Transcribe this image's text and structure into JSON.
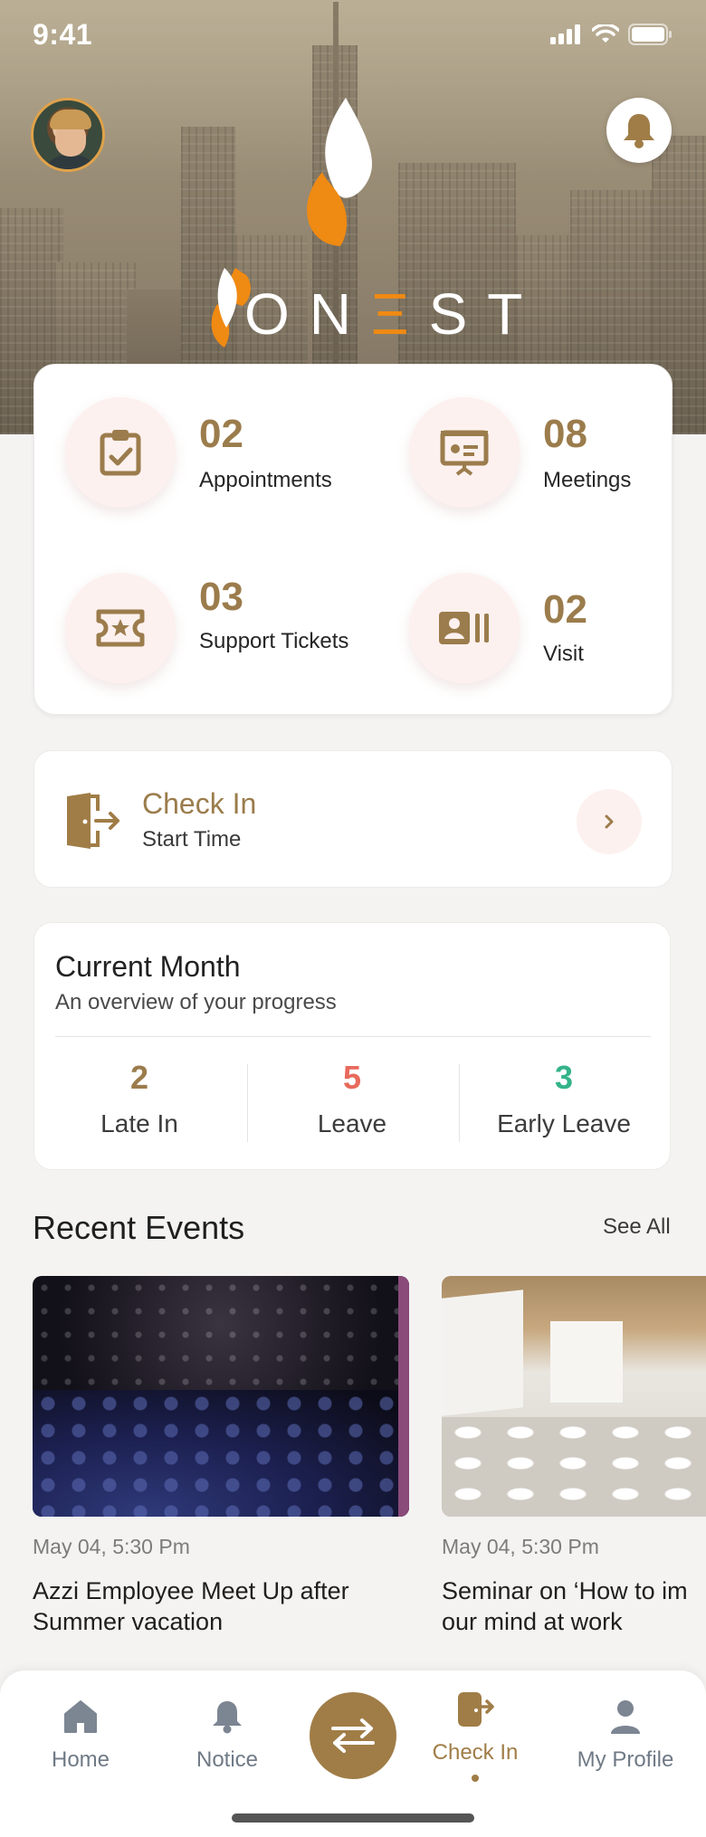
{
  "status_bar": {
    "time": "9:41"
  },
  "header": {
    "logo_text_pre": "ON",
    "logo_text_e": "Ξ",
    "logo_text_post": "ST"
  },
  "stats": [
    {
      "value": "02",
      "label": "Appointments",
      "icon": "clipboard-check-icon"
    },
    {
      "value": "08",
      "label": "Meetings",
      "icon": "presentation-board-icon"
    },
    {
      "value": "03",
      "label": "Support Tickets",
      "icon": "ticket-star-icon"
    },
    {
      "value": "02",
      "label": "Visit",
      "icon": "id-card-icon"
    }
  ],
  "checkin": {
    "title": "Check In",
    "subtitle": "Start Time"
  },
  "month": {
    "title": "Current Month",
    "subtitle": "An overview of your progress",
    "items": [
      {
        "value": "2",
        "label": "Late In",
        "color": "#9b7c4c"
      },
      {
        "value": "5",
        "label": "Leave",
        "color": "#e86a5c"
      },
      {
        "value": "3",
        "label": "Early Leave",
        "color": "#34b38a"
      }
    ]
  },
  "events": {
    "title": "Recent Events",
    "see_all": "See All",
    "items": [
      {
        "date": "May 04, 5:30 Pm",
        "title_line1": "Azzi Employee Meet Up after",
        "title_line2": "Summer vacation"
      },
      {
        "date": "May 04, 5:30 Pm",
        "title_line1": "Seminar on ‘How to im",
        "title_line2": "our mind at work"
      }
    ]
  },
  "nav": {
    "items": [
      {
        "label": "Home",
        "icon": "home-icon"
      },
      {
        "label": "Notice",
        "icon": "bell-icon"
      },
      {
        "label": "Check In",
        "icon": "check-in-icon"
      },
      {
        "label": "My Profile",
        "icon": "user-icon"
      }
    ],
    "center_icon": "swap-arrows-icon",
    "accent": "#a07d47"
  }
}
